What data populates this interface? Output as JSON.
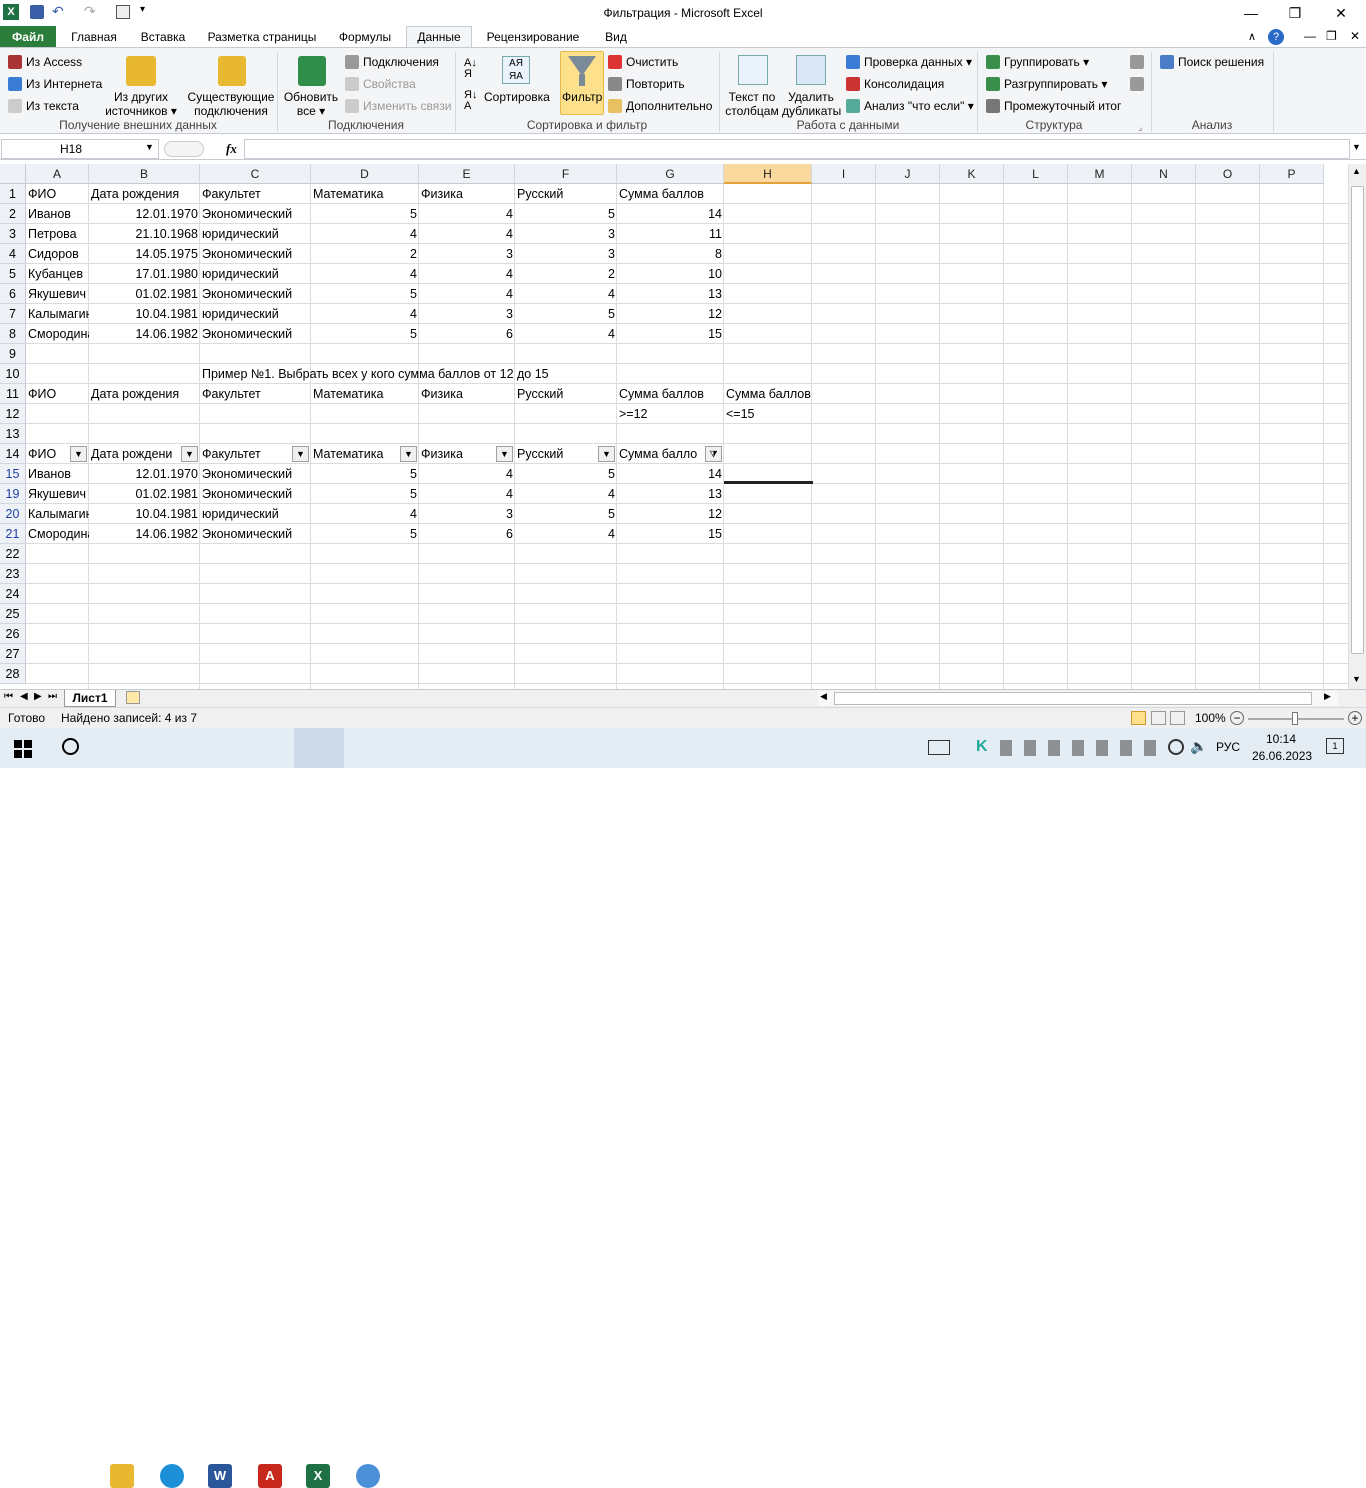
{
  "window": {
    "title": "Фильтрация  -  Microsoft Excel"
  },
  "tabs": [
    "Файл",
    "Главная",
    "Вставка",
    "Разметка страницы",
    "Формулы",
    "Данные",
    "Рецензирование",
    "Вид"
  ],
  "ribbon": {
    "ext_access": "Из Access",
    "ext_web": "Из Интернета",
    "ext_text": "Из текста",
    "ext_other_1": "Из других",
    "ext_other_2": "источников",
    "ext_existing_1": "Существующие",
    "ext_existing_2": "подключения",
    "grp_external": "Получение внешних данных",
    "refresh_1": "Обновить",
    "refresh_2": "все",
    "connections": "Подключения",
    "properties": "Свойства",
    "edit_links": "Изменить связи",
    "grp_connections": "Подключения",
    "sort": "Сортировка",
    "filter": "Фильтр",
    "clear": "Очистить",
    "reapply": "Повторить",
    "advanced": "Дополнительно",
    "grp_sort": "Сортировка и фильтр",
    "text_to_cols_1": "Текст по",
    "text_to_cols_2": "столбцам",
    "remove_dup_1": "Удалить",
    "remove_dup_2": "дубликаты",
    "validation": "Проверка данных",
    "consolidate": "Консолидация",
    "whatif": "Анализ \"что если\"",
    "grp_datatools": "Работа с данными",
    "group": "Группировать",
    "ungroup": "Разгруппировать",
    "subtotal": "Промежуточный итог",
    "grp_outline": "Структура",
    "solver": "Поиск решения",
    "grp_analysis": "Анализ"
  },
  "formula_bar": {
    "name_box": "H18",
    "fx": "fx",
    "value": ""
  },
  "columns": [
    "A",
    "B",
    "C",
    "D",
    "E",
    "F",
    "G",
    "H",
    "I",
    "J",
    "K",
    "L",
    "M",
    "N",
    "O",
    "P"
  ],
  "row_numbers": [
    "1",
    "2",
    "3",
    "4",
    "5",
    "6",
    "7",
    "8",
    "9",
    "10",
    "11",
    "12",
    "13",
    "14",
    "15",
    "19",
    "20",
    "21",
    "22",
    "23",
    "24",
    "25",
    "26",
    "27",
    "28"
  ],
  "sheet": {
    "headers": [
      "ФИО",
      "Дата рождения",
      "Факультет",
      "Математика",
      "Физика",
      "Русский",
      "Сумма баллов"
    ],
    "data": [
      [
        "Иванов",
        "12.01.1970",
        "Экономический",
        "5",
        "4",
        "5",
        "14"
      ],
      [
        "Петрова",
        "21.10.1968",
        "юридический",
        "4",
        "4",
        "3",
        "11"
      ],
      [
        "Сидоров",
        "14.05.1975",
        "Экономический",
        "2",
        "3",
        "3",
        "8"
      ],
      [
        "Кубанцев",
        "17.01.1980",
        "юридический",
        "4",
        "4",
        "2",
        "10"
      ],
      [
        "Якушевич",
        "01.02.1981",
        "Экономический",
        "5",
        "4",
        "4",
        "13"
      ],
      [
        "Калымагина",
        "10.04.1981",
        "юридический",
        "4",
        "3",
        "5",
        "12"
      ],
      [
        "Смородина",
        "14.06.1982",
        "Экономический",
        "5",
        "6",
        "4",
        "15"
      ]
    ],
    "example_title": "Пример №1. Выбрать всех у кого сумма баллов от 12 до 15",
    "criteria_headers": [
      "ФИО",
      "Дата рождения",
      "Факультет",
      "Математика",
      "Физика",
      "Русский",
      "Сумма баллов",
      "Сумма баллов"
    ],
    "criteria_values": [
      ">=12",
      "<=15"
    ],
    "filter_headers": [
      "ФИО",
      "Дата рождени",
      "Факультет",
      "Математика",
      "Физика",
      "Русский",
      "Сумма балло"
    ],
    "filtered": [
      [
        "Иванов",
        "12.01.1970",
        "Экономический",
        "5",
        "4",
        "5",
        "14"
      ],
      [
        "Якушевич",
        "01.02.1981",
        "Экономический",
        "5",
        "4",
        "4",
        "13"
      ],
      [
        "Калымагина",
        "10.04.1981",
        "юридический",
        "4",
        "3",
        "5",
        "12"
      ],
      [
        "Смородина",
        "14.06.1982",
        "Экономический",
        "5",
        "6",
        "4",
        "15"
      ]
    ]
  },
  "sheet_tab": "Лист1",
  "status": {
    "ready": "Готово",
    "found": "Найдено записей: 4 из 7",
    "zoom": "100%"
  },
  "taskbar": {
    "lang": "РУС",
    "time": "10:14",
    "date": "26.06.2023",
    "notif": "1"
  }
}
